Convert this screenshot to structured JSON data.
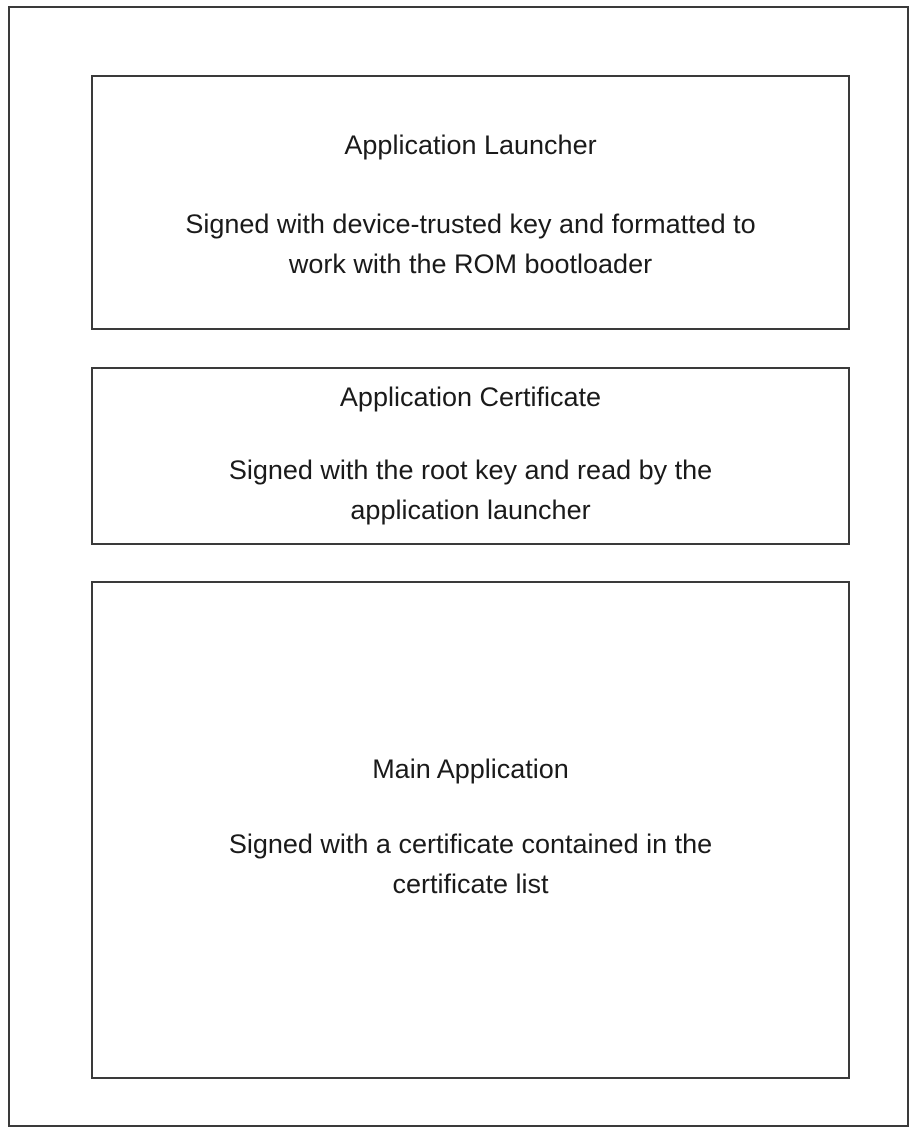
{
  "blocks": [
    {
      "title": "Application Launcher",
      "description": "Signed with device-trusted key and formatted to\nwork with the ROM bootloader"
    },
    {
      "title": "Application Certificate",
      "description": "Signed with the root key and read by the\napplication launcher"
    },
    {
      "title": "Main Application",
      "description": "Signed with a certificate contained in the\ncertificate list"
    }
  ]
}
